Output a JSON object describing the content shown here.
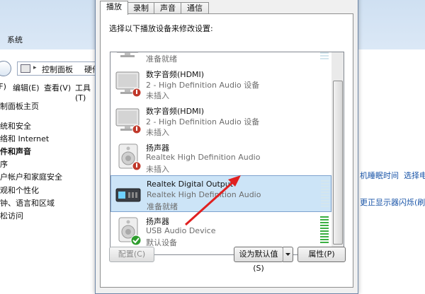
{
  "background": {
    "system_label": "系统",
    "address": {
      "part1": "控制面板",
      "part2": "硬件"
    },
    "menus": [
      "(F)",
      "编辑(E)",
      "查看(V)",
      "工具(T)"
    ],
    "sidebar": [
      "制面板主页",
      "统和安全",
      "络和 Internet",
      "件和声音",
      "序",
      "户帐户和家庭安全",
      "观和个性化",
      "钟、语言和区域",
      "松访问"
    ],
    "right_links": [
      "机睡眠时间",
      "选择电",
      "更正显示器闪烁(刷新率"
    ]
  },
  "dialog": {
    "tabs": [
      "播放",
      "录制",
      "声音",
      "通信"
    ],
    "instruction": "选择以下播放设备来修改设置:",
    "devices": [
      {
        "name": "",
        "desc": "2 - High Definition Audio 设备",
        "status": "准备就绪",
        "icon": "monitor-speaker-icon",
        "state": "ready"
      },
      {
        "name": "数字音频(HDMI)",
        "desc": "2 - High Definition Audio 设备",
        "status": "未插入",
        "icon": "monitor-speaker-icon",
        "state": "unplugged"
      },
      {
        "name": "数字音频(HDMI)",
        "desc": "2 - High Definition Audio 设备",
        "status": "未插入",
        "icon": "monitor-speaker-icon",
        "state": "unplugged"
      },
      {
        "name": "扬声器",
        "desc": "Realtek High Definition Audio",
        "status": "未插入",
        "icon": "speaker-icon",
        "state": "unplugged"
      },
      {
        "name": "Realtek Digital Output",
        "desc": "Realtek High Definition Audio",
        "status": "准备就绪",
        "icon": "digital-output-icon",
        "state": "selected"
      },
      {
        "name": "扬声器",
        "desc": "USB Audio Device",
        "status": "默认设备",
        "icon": "speaker-icon",
        "state": "default"
      }
    ],
    "buttons": {
      "configure": "配置(C)",
      "set_default": "设为默认值(S)",
      "properties": "属性(P)"
    },
    "colors": {
      "selection": "#cce4f7",
      "meter_active": "#3cb043",
      "check_green": "#2e9d2e",
      "unplugged_red": "#c0392b",
      "arrow_red": "#e02020"
    }
  }
}
